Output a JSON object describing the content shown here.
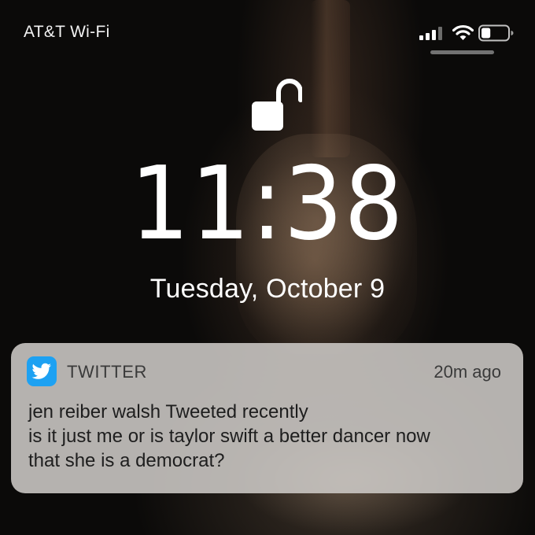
{
  "status_bar": {
    "carrier": "AT&T Wi-Fi",
    "signal_icon": "cellular-signal",
    "wifi_icon": "wifi",
    "battery_icon": "battery",
    "battery_level": 0.35
  },
  "lock_screen": {
    "lock_icon": "unlocked-padlock",
    "time": "11:38",
    "date": "Tuesday, October 9"
  },
  "notification": {
    "app_icon": "twitter-bird",
    "app_color": "#1da1f2",
    "app_name": "TWITTER",
    "time_ago": "20m ago",
    "lines": [
      "jen reiber walsh Tweeted recently",
      "is it just me or is taylor swift a better dancer now",
      "that she is a democrat?"
    ]
  }
}
